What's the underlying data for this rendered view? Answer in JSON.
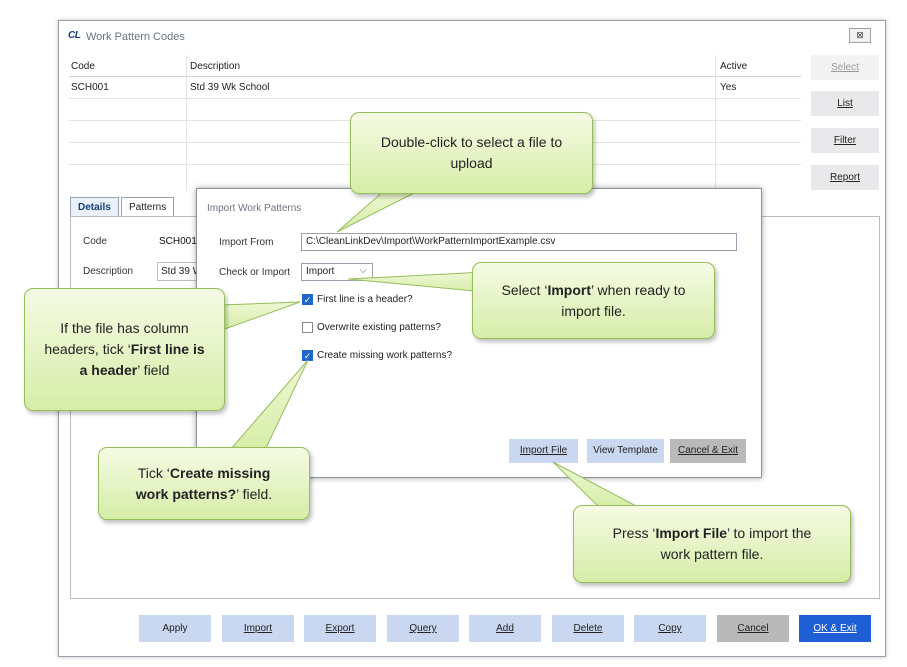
{
  "window": {
    "logo": "CL",
    "title": "Work Pattern Codes",
    "close": "⊠"
  },
  "grid": {
    "headers": {
      "code": "Code",
      "description": "Description",
      "active": "Active"
    },
    "rows": [
      {
        "code": "SCH001",
        "description": "Std 39 Wk School",
        "active": "Yes"
      }
    ]
  },
  "side_buttons": {
    "select": "Select",
    "list": "List",
    "filter": "Filter",
    "report": "Report"
  },
  "tabs": {
    "details": "Details",
    "patterns": "Patterns"
  },
  "details": {
    "code_label": "Code",
    "code_value": "SCH001",
    "description_label": "Description",
    "description_value": "Std 39 Wk School"
  },
  "bottom_buttons": {
    "apply": "Apply",
    "import": "Import",
    "export": "Export",
    "query": "Query",
    "add": "Add",
    "delete": "Delete",
    "copy": "Copy",
    "cancel": "Cancel",
    "ok_exit": "OK & Exit"
  },
  "dialog": {
    "title": "Import Work Patterns",
    "import_from_label": "Import From",
    "import_from_value": "C:\\CleanLinkDev\\Import\\WorkPatternImportExample.csv",
    "check_or_import_label": "Check or Import",
    "check_or_import_value": "Import",
    "first_line_header": {
      "label": "First line is a header?",
      "checked": true
    },
    "overwrite_existing": {
      "label": "Overwrite existing patterns?",
      "checked": false
    },
    "create_missing": {
      "label": "Create missing work patterns?",
      "checked": true
    },
    "buttons": {
      "import_file": "Import File",
      "view_template": "View Template",
      "cancel_exit": "Cancel & Exit"
    }
  },
  "callouts": {
    "double_click": "Double-click to select a file to upload",
    "select_import_pre": "Select ‘",
    "select_import_bold": "Import",
    "select_import_post": "’ when ready to import file.",
    "header_pre": "If the file has column headers, tick ‘",
    "header_bold": "First line is a header",
    "header_post": "’ field",
    "create_pre": "Tick ‘",
    "create_bold": "Create missing work patterns?",
    "create_post": "’ field.",
    "press_pre": "Press ‘",
    "press_bold": "Import File",
    "press_post": "’ to import the work pattern file."
  }
}
